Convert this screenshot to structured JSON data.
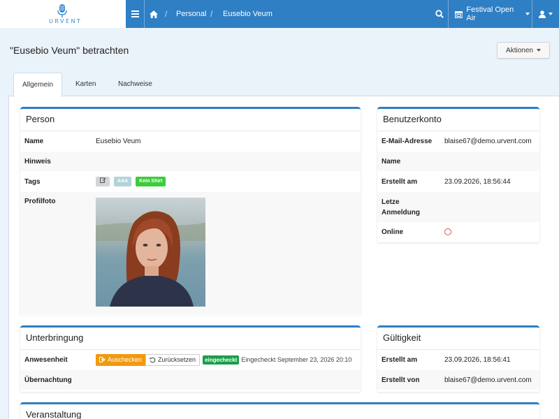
{
  "brand": {
    "name": "URVENT"
  },
  "navbar": {
    "breadcrumbs": [
      "Personal",
      "Eusebio Veum"
    ],
    "festival": "Festival Open Air"
  },
  "page": {
    "title": "\"Eusebio Veum\" betrachten",
    "actions_label": "Aktionen"
  },
  "tabs": [
    "Allgemein",
    "Karten",
    "Nachweise"
  ],
  "person": {
    "title": "Person",
    "name_label": "Name",
    "name_value": "Eusebio Veum",
    "hint_label": "Hinweis",
    "tags_label": "Tags",
    "tags": [
      "AAA",
      "Kein Shirt"
    ],
    "photo_label": "Profilfoto"
  },
  "account": {
    "title": "Benutzerkonto",
    "email_label": "E-Mail-Adresse",
    "email_value": "blaise67@demo.urvent.com",
    "name_label": "Name",
    "created_label": "Erstellt am",
    "created_value": "23.09.2026, 18:56:44",
    "last_login_label_1": "Letze",
    "last_login_label_2": "Anmeldung",
    "online_label": "Online"
  },
  "accommodation": {
    "title": "Unterbringung",
    "presence_label": "Anwesenheit",
    "checkout_button": "Auschecken",
    "reset_button": "Zurücksetzen",
    "status_badge": "eingecheckt",
    "status_text": "Eingecheckt September 23, 2026 20:10",
    "overnight_label": "Übernachtung"
  },
  "validity": {
    "title": "Gültigkeit",
    "created_label": "Erstellt am",
    "created_value": "23.09.2026, 18:56:41",
    "created_by_label": "Erstellt von",
    "created_by_value": "blaise67@demo.urvent.com"
  },
  "event": {
    "title": "Veranstaltung"
  },
  "colors": {
    "primary": "#2e7fc4",
    "warning": "#f29a0e",
    "success": "#1a9e4a",
    "tag_green": "#3ccc3c",
    "tag_aaa": "#b2d4d9",
    "danger": "#d9534f"
  }
}
